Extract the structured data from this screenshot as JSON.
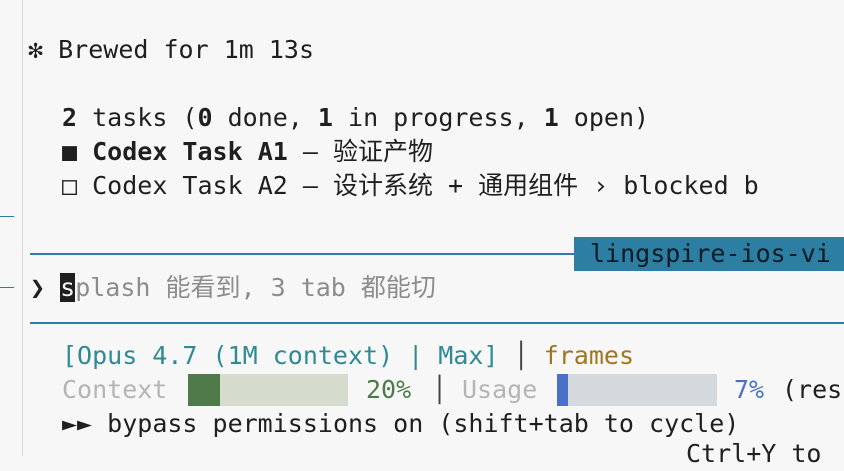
{
  "status": {
    "icon": "asterisk-icon",
    "glyph": "✻",
    "text": "Brewed for 1m 13s"
  },
  "tasks": {
    "count": "2",
    "summary_pre": " tasks (",
    "done_count": "0",
    "done_label": " done, ",
    "in_progress_count": "1",
    "in_progress_label": " in progress, ",
    "open_count": "1",
    "open_label": " open)",
    "items": [
      {
        "glyph": "■",
        "label": "Codex Task A1",
        "suffix": " — 验证产物"
      },
      {
        "glyph": "□",
        "label": "Codex Task A2",
        "suffix": " — 设计系统 + 通用组件 › blocked b"
      }
    ]
  },
  "session_badge": "lingspire-ios-vi",
  "prompt": {
    "glyph": "❯",
    "cursor_char": "s",
    "placeholder_rest": "plash 能看到, 3 tab 都能切"
  },
  "statusline": {
    "model": "[Opus 4.7 (1M context) | Max]",
    "divider": "│",
    "style": "frames",
    "context_label": "Context",
    "context_pct": "20%",
    "context_value": 0.2,
    "usage_label": "Usage",
    "usage_pct": "7%",
    "usage_value": 0.07,
    "usage_tail": "(res",
    "colors": {
      "context_fill": "#4f7a4a",
      "context_track": "#d6dccd",
      "usage_fill": "#4a72c4",
      "usage_track": "#d4d9de"
    }
  },
  "mode_line": {
    "glyph": "►►",
    "text": "bypass permissions on (shift+tab to cycle)"
  },
  "hint": "Ctrl+Y to"
}
